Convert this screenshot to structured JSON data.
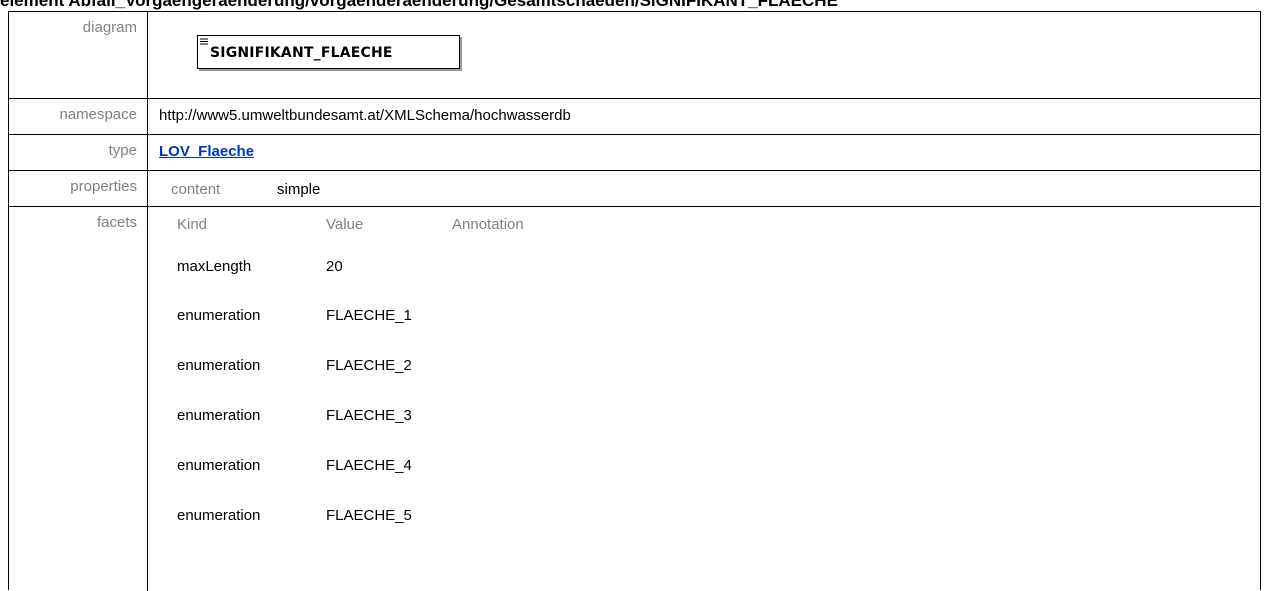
{
  "heading": "element Abfall_Vorgaengeraenderung/vorgaenderaenderung/Gesamtschaeden/SIGNIFIKANT_FLAECHE",
  "rows": {
    "diagram": {
      "label": "diagram",
      "element_name": "SIGNIFIKANT_FLAECHE"
    },
    "namespace": {
      "label": "namespace",
      "value": "http://www5.umweltbundesamt.at/XMLSchema/hochwasserdb"
    },
    "type": {
      "label": "type",
      "value": "LOV_Flaeche"
    },
    "properties": {
      "label": "properties",
      "key": "content",
      "value": "simple"
    },
    "facets": {
      "label": "facets",
      "headers": [
        "Kind",
        "Value",
        "Annotation"
      ],
      "items": [
        {
          "kind": "maxLength",
          "value": "20"
        },
        {
          "kind": "enumeration",
          "value": "FLAECHE_1"
        },
        {
          "kind": "enumeration",
          "value": "FLAECHE_2"
        },
        {
          "kind": "enumeration",
          "value": "FLAECHE_3"
        },
        {
          "kind": "enumeration",
          "value": "FLAECHE_4"
        },
        {
          "kind": "enumeration",
          "value": "FLAECHE_5"
        }
      ]
    }
  }
}
